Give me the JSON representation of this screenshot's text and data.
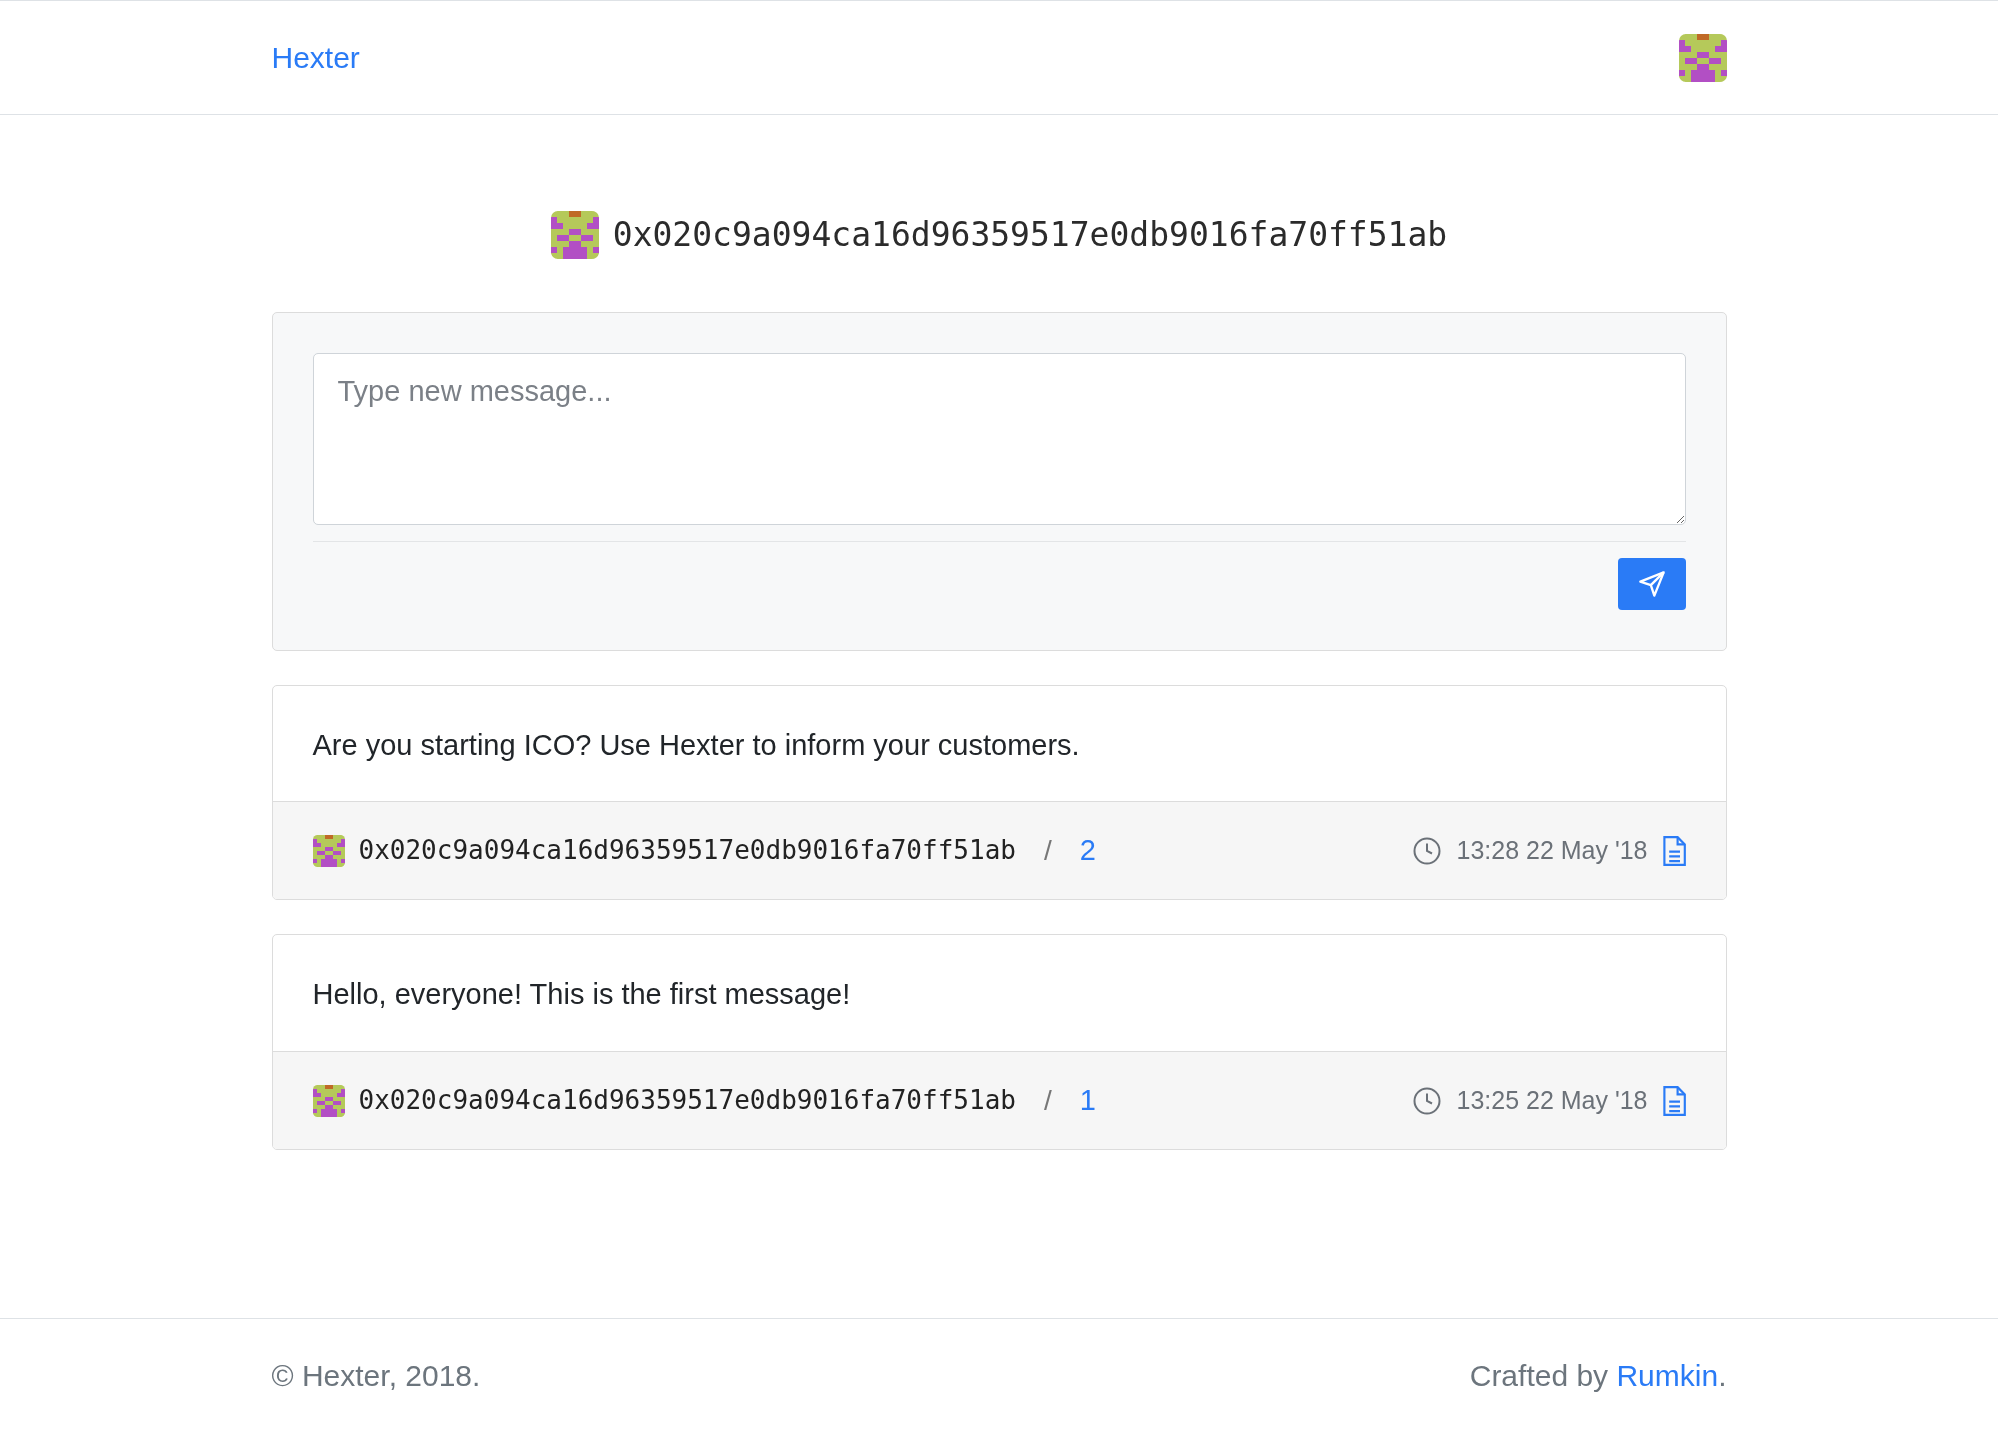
{
  "navbar": {
    "brand": "Hexter"
  },
  "profile": {
    "address": "0x020c9a094ca16d96359517e0db9016fa70ff51ab"
  },
  "composer": {
    "placeholder": "Type new message..."
  },
  "messages": [
    {
      "text": "Are you starting ICO? Use Hexter to inform your customers.",
      "author": "0x020c9a094ca16d96359517e0db9016fa70ff51ab",
      "separator": "/",
      "number": "2",
      "time": "13:28 22 May '18"
    },
    {
      "text": "Hello, everyone! This is the first message!",
      "author": "0x020c9a094ca16d96359517e0db9016fa70ff51ab",
      "separator": "/",
      "number": "1",
      "time": "13:25 22 May '18"
    }
  ],
  "footer": {
    "copyright": "© Hexter, 2018.",
    "credit_prefix": "Crafted by ",
    "credit_link": "Rumkin",
    "credit_suffix": "."
  }
}
